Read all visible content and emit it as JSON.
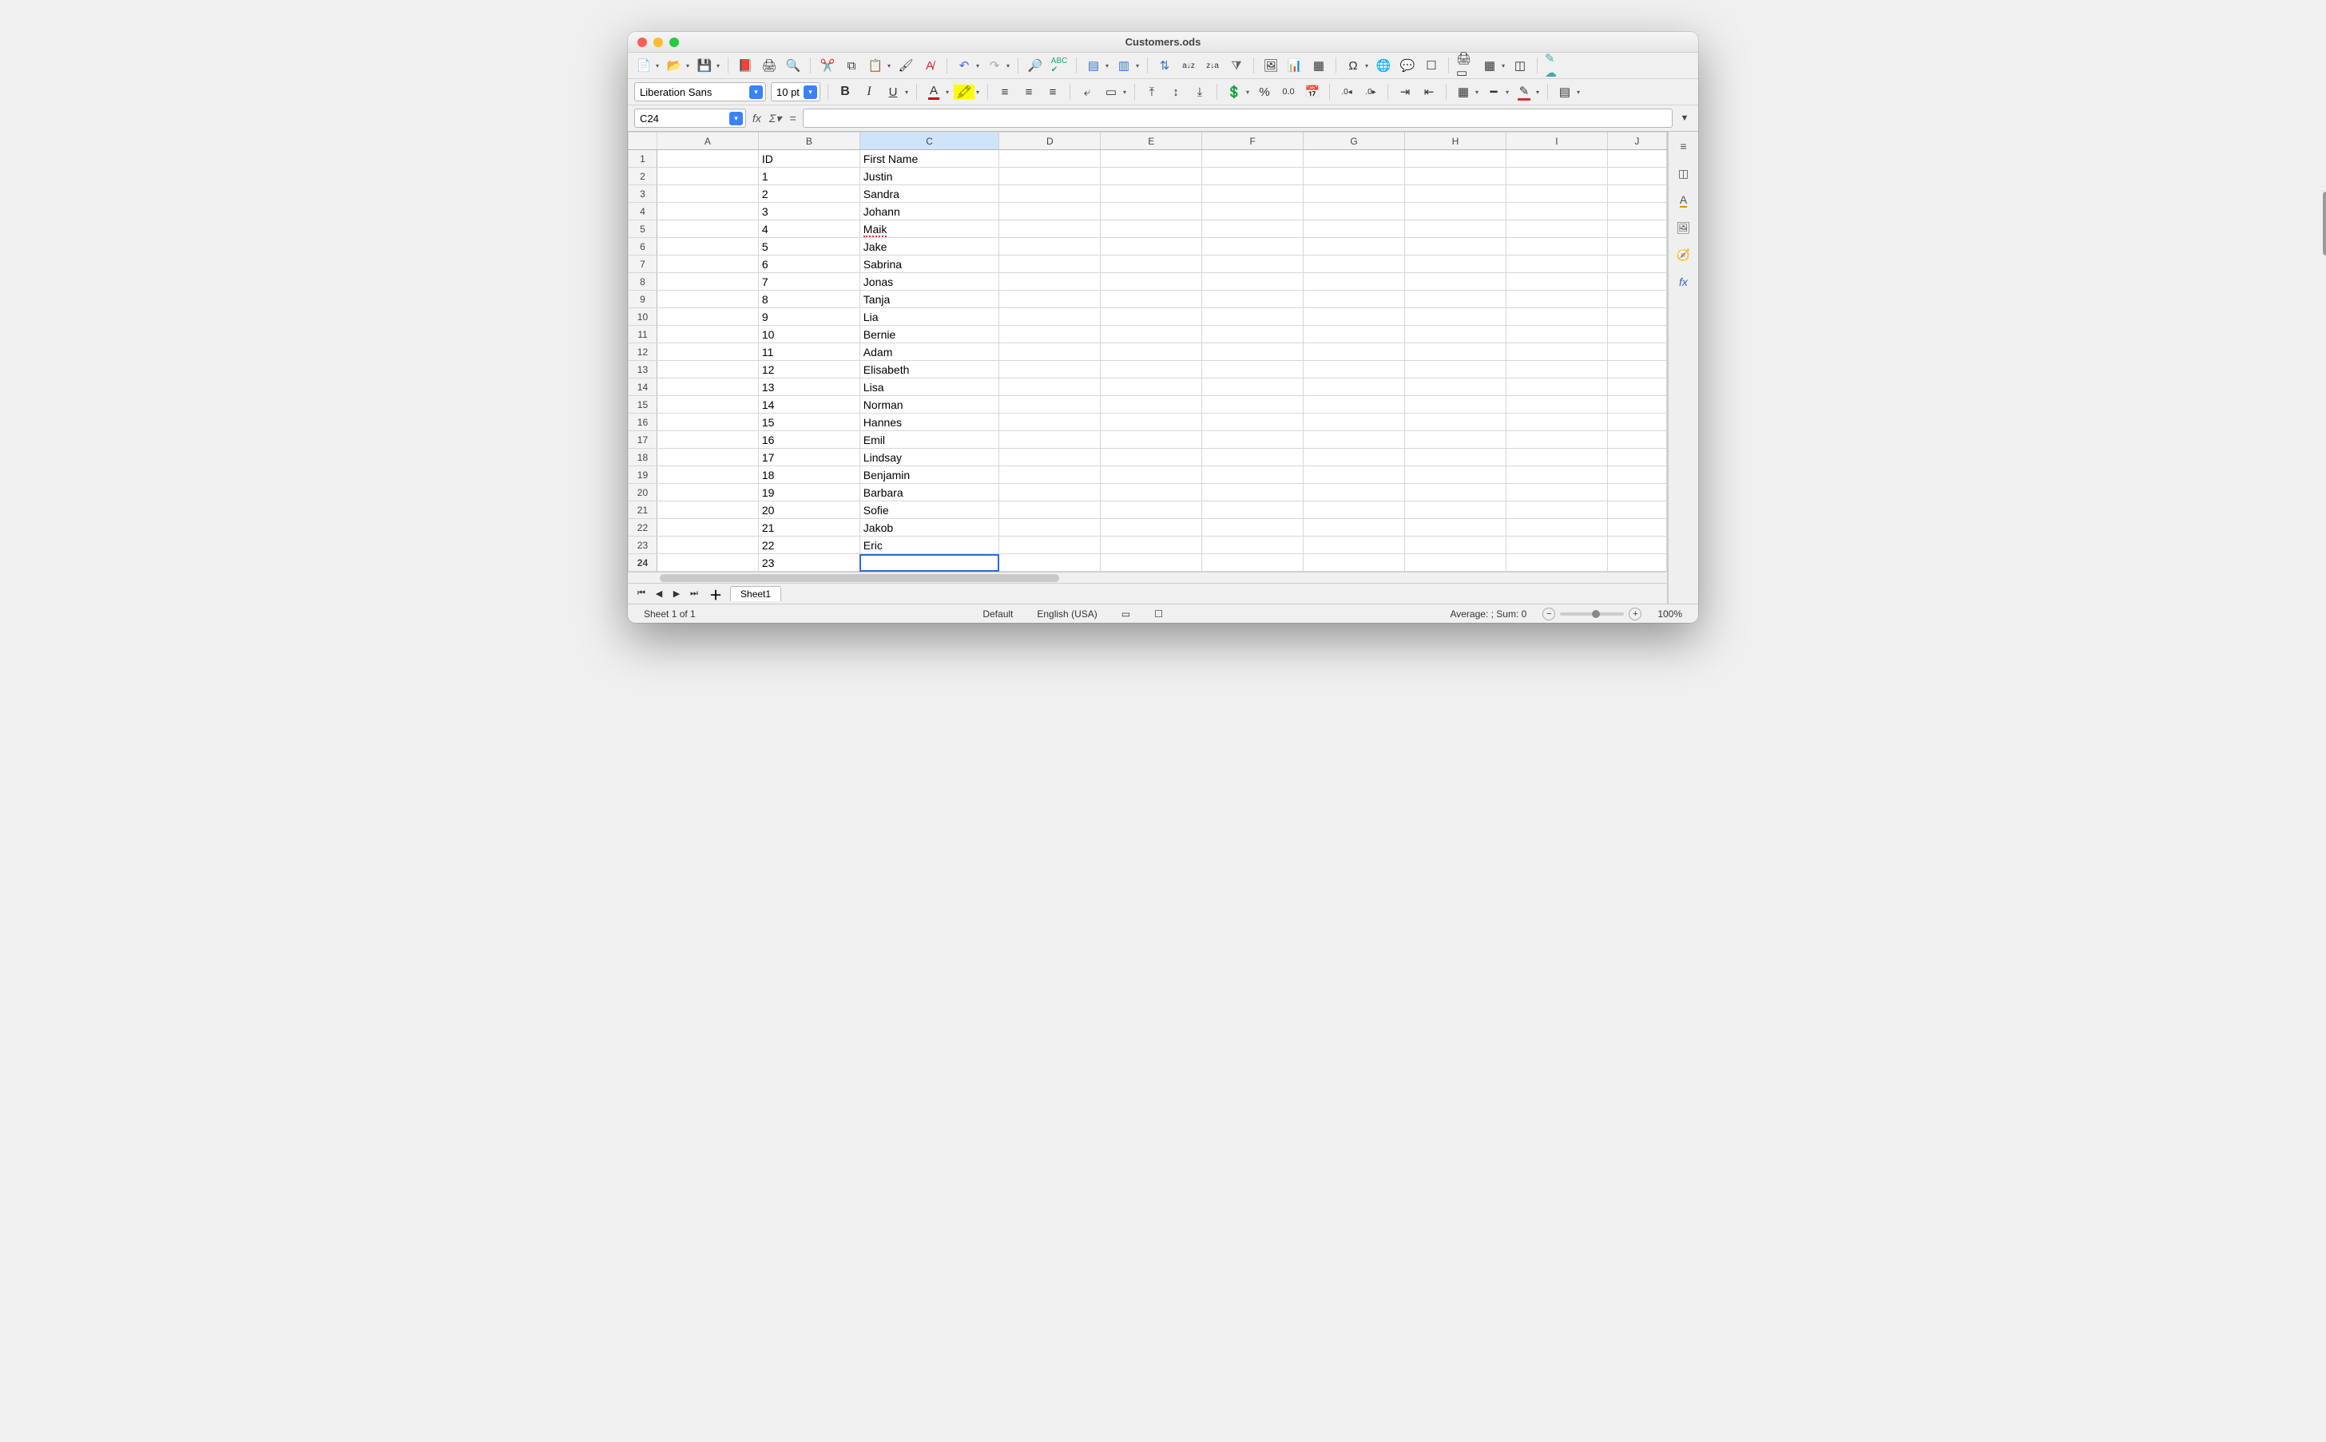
{
  "window": {
    "title": "Customers.ods"
  },
  "fontbar": {
    "font_name": "Liberation Sans",
    "font_size": "10 pt"
  },
  "formulabar": {
    "cell_ref": "C24",
    "formula": ""
  },
  "columns": [
    "A",
    "B",
    "C",
    "D",
    "E",
    "F",
    "G",
    "H",
    "I",
    "J"
  ],
  "selected_column": "C",
  "selected_row": 24,
  "rows_visible": 24,
  "sheet_data": {
    "header": {
      "B": "ID",
      "C": "First Name"
    },
    "rows": [
      {
        "B": "1",
        "C": "Justin"
      },
      {
        "B": "2",
        "C": "Sandra"
      },
      {
        "B": "3",
        "C": "Johann"
      },
      {
        "B": "4",
        "C": "Maik"
      },
      {
        "B": "5",
        "C": "Jake"
      },
      {
        "B": "6",
        "C": "Sabrina"
      },
      {
        "B": "7",
        "C": "Jonas"
      },
      {
        "B": "8",
        "C": "Tanja"
      },
      {
        "B": "9",
        "C": "Lia"
      },
      {
        "B": "10",
        "C": "Bernie"
      },
      {
        "B": "11",
        "C": "Adam"
      },
      {
        "B": "12",
        "C": "Elisabeth"
      },
      {
        "B": "13",
        "C": "Lisa"
      },
      {
        "B": "14",
        "C": "Norman"
      },
      {
        "B": "15",
        "C": "Hannes"
      },
      {
        "B": "16",
        "C": "Emil"
      },
      {
        "B": "17",
        "C": "Lindsay"
      },
      {
        "B": "18",
        "C": "Benjamin"
      },
      {
        "B": "19",
        "C": "Barbara"
      },
      {
        "B": "20",
        "C": "Sofie"
      },
      {
        "B": "21",
        "C": "Jakob"
      },
      {
        "B": "22",
        "C": "Eric"
      },
      {
        "B": "23",
        "C": ""
      }
    ]
  },
  "tabs": {
    "active": "Sheet1"
  },
  "statusbar": {
    "sheet_info": "Sheet 1 of 1",
    "page_style": "Default",
    "language": "English (USA)",
    "aggregate": "Average: ; Sum: 0",
    "zoom": "100%"
  }
}
